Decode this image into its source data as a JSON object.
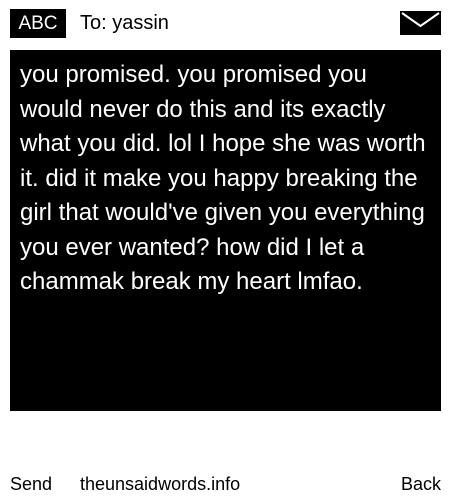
{
  "header": {
    "badge_label": "ABC",
    "to_label": "To: yassin",
    "mail_icon": "envelope-icon"
  },
  "message": {
    "text": "you promised. you promised you would never do this and its exactly what you did. lol I hope she was worth it. did it make you happy breaking the girl that would've given you everything you ever wanted? how did I let a chammak break my heart lmfao."
  },
  "footer": {
    "send_label": "Send",
    "site_label": "theunsaidwords.info",
    "back_label": "Back"
  },
  "colors": {
    "background": "#ffffff",
    "message_bg": "#000000",
    "message_text": "#ffffff",
    "text": "#000000"
  }
}
